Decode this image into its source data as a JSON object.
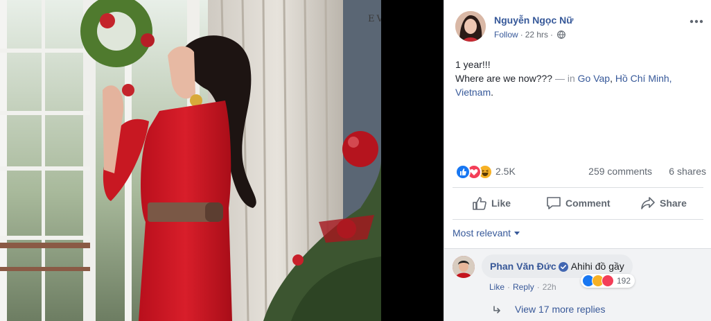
{
  "photo": {
    "watermark": "EV"
  },
  "post": {
    "author": "Nguyễn Ngọc Nữ",
    "follow": "Follow",
    "time": "22 hrs",
    "text_line1": "1 year!!!",
    "text_line2": "Where are we now???",
    "dash_in": "— in",
    "location_1": "Go Vap",
    "comma": ",",
    "location_2": "Hồ Chí Minh, Vietnam",
    "period": ".",
    "more_icon": "more-dots-icon"
  },
  "stats": {
    "reaction_count": "2.5K",
    "comments": "259 comments",
    "shares": "6 shares",
    "reactions": [
      "like-reaction",
      "love-reaction",
      "haha-reaction"
    ],
    "colors": {
      "like": "#1877f2",
      "love": "#f33e58",
      "haha": "#f7b125"
    }
  },
  "actions": {
    "like": "Like",
    "comment": "Comment",
    "share": "Share"
  },
  "filter": {
    "label": "Most relevant"
  },
  "comment": {
    "name": "Phan Văn Đức",
    "text": "Ahihi đồ gầy",
    "reaction_count": "192",
    "like": "Like",
    "reply": "Reply",
    "separator": "·",
    "time": "22h",
    "view_more": "View 17 more replies"
  }
}
